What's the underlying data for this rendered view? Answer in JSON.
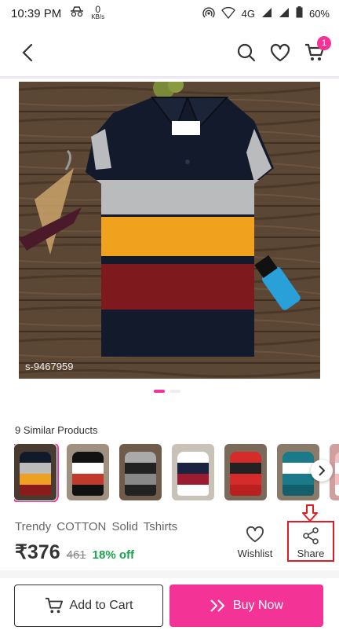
{
  "status_bar": {
    "time": "10:39 PM",
    "net_speed_value": "0",
    "net_speed_unit": "KB/s",
    "network": "4G",
    "battery": "60%"
  },
  "header": {
    "cart_count": "1"
  },
  "product": {
    "sku": "s-9467959",
    "name": "Trendy  COTTON  Solid Tshirts",
    "price": "₹376",
    "mrp": "461",
    "discount": "18% off"
  },
  "similar": {
    "title": "9 Similar Products",
    "items": [
      {
        "bg": "#4a3b30",
        "stripes": [
          "#111a2b",
          "#bbbbbb",
          "#f0a020",
          "#8b1a1a"
        ]
      },
      {
        "bg": "#a09080",
        "stripes": [
          "#111111",
          "#ffffff",
          "#c0392b",
          "#111111"
        ]
      },
      {
        "bg": "#6e5b4a",
        "stripes": [
          "#aaaaaa",
          "#222222",
          "#888888",
          "#222222"
        ]
      },
      {
        "bg": "#c8c2b8",
        "stripes": [
          "#ffffff",
          "#1a2340",
          "#9b1b30",
          "#ffffff"
        ]
      },
      {
        "bg": "#7a6a5a",
        "stripes": [
          "#d62b2b",
          "#222222",
          "#d62b2b",
          "#bb2020"
        ]
      },
      {
        "bg": "#8a7a6a",
        "stripes": [
          "#1a7a8a",
          "#ffffff",
          "#1a7a8a",
          "#135f6c"
        ]
      },
      {
        "bg": "#d0a0a0",
        "stripes": [
          "#f0c0c0",
          "#ffffff",
          "#f0c0c0",
          "#ffffff"
        ]
      }
    ]
  },
  "actions": {
    "wishlist_label": "Wishlist",
    "share_label": "Share",
    "add_to_cart_label": "Add to Cart",
    "buy_now_label": "Buy Now"
  },
  "colors": {
    "accent": "#f43397",
    "discount": "#1aa34a",
    "highlight": "#e01b24"
  },
  "icons": [
    "back-arrow-icon",
    "search-icon",
    "heart-icon",
    "cart-icon",
    "chevron-right-icon",
    "share-icon",
    "cart-outline-icon",
    "double-chevron-right-icon"
  ]
}
